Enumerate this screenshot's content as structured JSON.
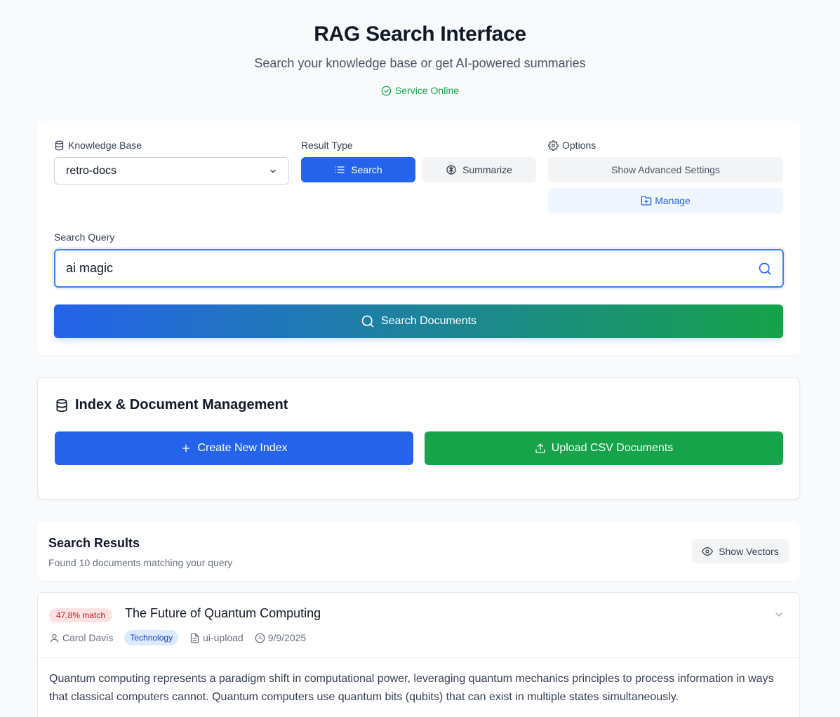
{
  "header": {
    "title": "RAG Search Interface",
    "subtitle": "Search your knowledge base or get AI-powered summaries",
    "status": "Service Online"
  },
  "search_panel": {
    "knowledge_base_label": "Knowledge Base",
    "knowledge_base_value": "retro-docs",
    "result_type_label": "Result Type",
    "search_label": "Search",
    "summarize_label": "Summarize",
    "options_label": "Options",
    "advanced_settings_label": "Show Advanced Settings",
    "manage_label": "Manage",
    "query_label": "Search Query",
    "query_value": "ai magic",
    "submit_label": "Search Documents"
  },
  "management": {
    "title": "Index & Document Management",
    "create_label": "Create New Index",
    "upload_label": "Upload CSV Documents"
  },
  "results": {
    "title": "Search Results",
    "summary": "Found 10 documents matching your query",
    "vectors_label": "Show Vectors",
    "items": [
      {
        "match": "47.8% match",
        "title": "The Future of Quantum Computing",
        "author": "Carol Davis",
        "category": "Technology",
        "source": "ui-upload",
        "date": "9/9/2025",
        "body": "Quantum computing represents a paradigm shift in computational power, leveraging quantum mechanics principles to process information in ways that classical computers cannot. Quantum computers use quantum bits (qubits) that can exist in multiple states simultaneously."
      }
    ]
  },
  "colors": {
    "primary": "#2563eb",
    "success": "#16a34a",
    "background": "#f8fafc",
    "match_badge_bg": "#fee2e2",
    "category_badge_bg": "#dbeafe"
  }
}
